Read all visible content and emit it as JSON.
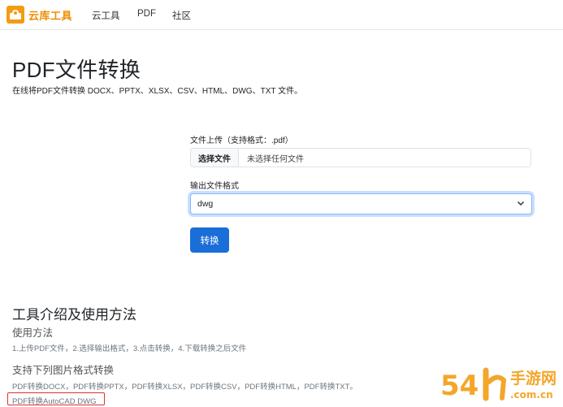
{
  "brand": {
    "name": "云库工具"
  },
  "nav": {
    "links": [
      "云工具",
      "PDF",
      "社区"
    ]
  },
  "page": {
    "title": "PDF文件转换",
    "subtitle": "在线将PDF文件转换 DOCX、PPTX、XLSX、CSV、HTML、DWG、TXT 文件。"
  },
  "form": {
    "upload_label": "文件上传（支持格式：.pdf）",
    "file_button": "选择文件",
    "file_status": "未选择任何文件",
    "output_label": "输出文件格式",
    "output_value": "dwg",
    "convert_button": "转换"
  },
  "intro": {
    "title": "工具介绍及使用方法",
    "usage_heading": "使用方法",
    "usage_text": "1.上传PDF文件，2.选择输出格式，3.点击转换，4.下载转换之后文件",
    "support_heading": "支持下列图片格式转换",
    "support_text": "PDF转换DOCX，PDF转换PPTX，PDF转换XLSX，PDF转换CSV，PDF转换HTML，PDF转换TXT。",
    "support_text2": "PDF转换AutoCAD DWG"
  },
  "watermark": {
    "main": "手游网",
    "site": ".com.cn",
    "digits": "54"
  },
  "colors": {
    "brand": "#f08c00",
    "primary": "#1a6ed8",
    "highlight": "#e03131"
  }
}
